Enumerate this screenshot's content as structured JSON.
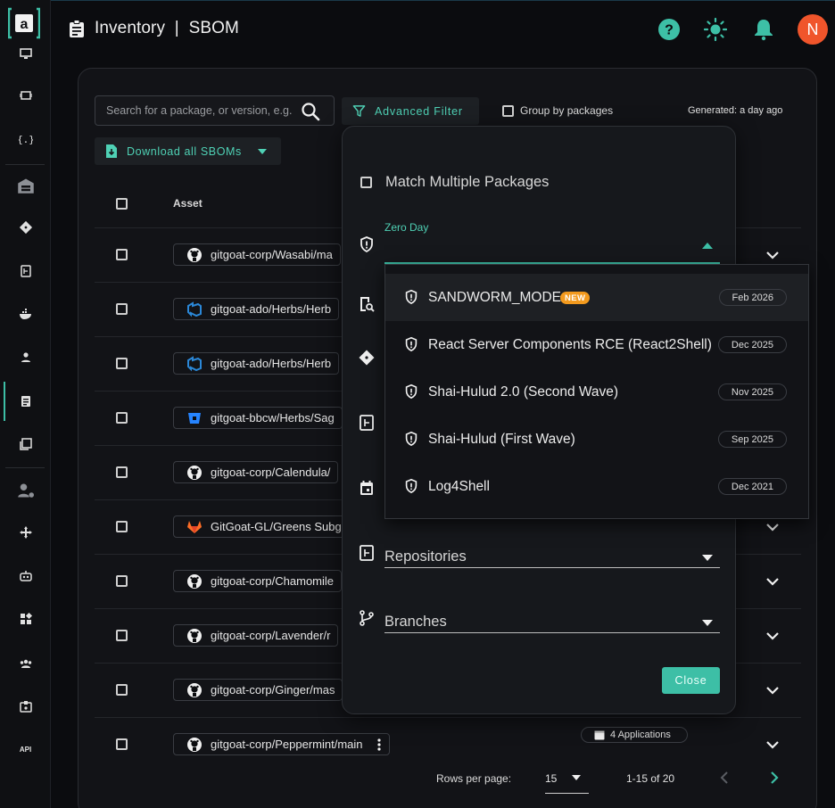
{
  "header": {
    "title": "Inventory  |  SBOM"
  },
  "avatar": {
    "initial": "N"
  },
  "toolbar": {
    "search_placeholder": "Search for a package, or version, e.g.",
    "advanced_filter_label": "Advanced Filter",
    "group_by_label": "Group by packages",
    "generated_text": "Generated: a day ago",
    "download_label": "Download all SBOMs"
  },
  "table": {
    "asset_header": "Asset",
    "rows": [
      {
        "provider": "github",
        "asset": "gitgoat-corp/Wasabi/ma"
      },
      {
        "provider": "azure",
        "asset": "gitgoat-ado/Herbs/Herb"
      },
      {
        "provider": "azure",
        "asset": "gitgoat-ado/Herbs/Herb"
      },
      {
        "provider": "bitbucket",
        "asset": "gitgoat-bbcw/Herbs/Sag"
      },
      {
        "provider": "github",
        "asset": "gitgoat-corp/Calendula/"
      },
      {
        "provider": "gitlab",
        "asset": "GitGoat-GL/Greens Subg"
      },
      {
        "provider": "github",
        "asset": "gitgoat-corp/Chamomile"
      },
      {
        "provider": "github",
        "asset": "gitgoat-corp/Lavender/r"
      },
      {
        "provider": "github",
        "asset": "gitgoat-corp/Ginger/mas"
      },
      {
        "provider": "github",
        "asset": "gitgoat-corp/Peppermint/main"
      }
    ],
    "apps_badge": "4 Applications"
  },
  "pagination": {
    "rows_per_page_label": "Rows per page:",
    "rows_per_page_value": "15",
    "range_text": "1-15 of 20"
  },
  "filter": {
    "match_multiple_label": "Match Multiple Packages",
    "zero_day_label": "Zero Day",
    "repositories_label": "Repositories",
    "branches_label": "Branches",
    "close_label": "Close",
    "zero_day_options": [
      {
        "name": "SANDWORM_MODE",
        "badge": "NEW",
        "date": "Feb 2026"
      },
      {
        "name": "React Server Components RCE (React2Shell)",
        "date": "Dec 2025"
      },
      {
        "name": "Shai-Hulud 2.0 (Second Wave)",
        "date": "Nov 2025"
      },
      {
        "name": "Shai-Hulud (First Wave)",
        "date": "Sep 2025"
      },
      {
        "name": "Log4Shell",
        "date": "Dec 2021"
      }
    ]
  },
  "sidebar": {
    "api_label": "API"
  },
  "colors": {
    "accent": "#3dbfa6",
    "new_badge": "#f39a1e",
    "avatar": "#f0552b"
  }
}
